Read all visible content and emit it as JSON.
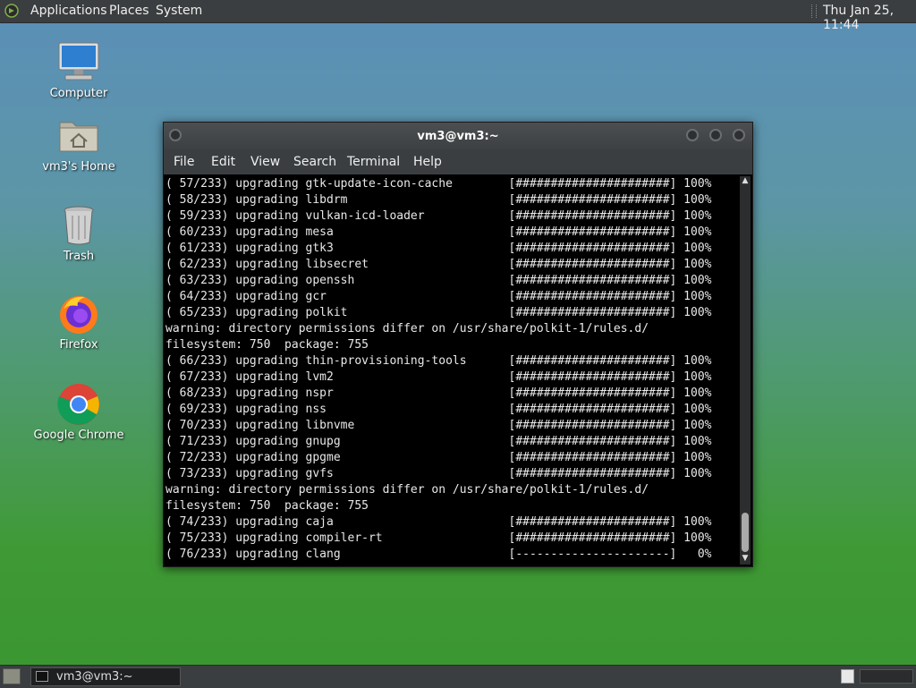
{
  "top_panel": {
    "menus": [
      "Applications",
      "Places",
      "System"
    ],
    "clock": "Thu Jan 25, 11:44"
  },
  "desktop_icons": [
    {
      "label": "Computer",
      "icon": "computer-icon"
    },
    {
      "label": "vm3's Home",
      "icon": "home-folder-icon"
    },
    {
      "label": "Trash",
      "icon": "trash-icon"
    },
    {
      "label": "Firefox",
      "icon": "firefox-icon"
    },
    {
      "label": "Google Chrome",
      "icon": "chrome-icon"
    }
  ],
  "window": {
    "title": "vm3@vm3:~",
    "menu": [
      "File",
      "Edit",
      "View",
      "Search",
      "Terminal",
      "Help"
    ]
  },
  "terminal_lines": [
    "( 57/233) upgrading gtk-update-icon-cache        [######################] 100%",
    "( 58/233) upgrading libdrm                       [######################] 100%",
    "( 59/233) upgrading vulkan-icd-loader            [######################] 100%",
    "( 60/233) upgrading mesa                         [######################] 100%",
    "( 61/233) upgrading gtk3                         [######################] 100%",
    "( 62/233) upgrading libsecret                    [######################] 100%",
    "( 63/233) upgrading openssh                      [######################] 100%",
    "( 64/233) upgrading gcr                          [######################] 100%",
    "( 65/233) upgrading polkit                       [######################] 100%",
    "warning: directory permissions differ on /usr/share/polkit-1/rules.d/",
    "filesystem: 750  package: 755",
    "( 66/233) upgrading thin-provisioning-tools      [######################] 100%",
    "( 67/233) upgrading lvm2                         [######################] 100%",
    "( 68/233) upgrading nspr                         [######################] 100%",
    "( 69/233) upgrading nss                          [######################] 100%",
    "( 70/233) upgrading libnvme                      [######################] 100%",
    "( 71/233) upgrading gnupg                        [######################] 100%",
    "( 72/233) upgrading gpgme                        [######################] 100%",
    "( 73/233) upgrading gvfs                         [######################] 100%",
    "warning: directory permissions differ on /usr/share/polkit-1/rules.d/",
    "filesystem: 750  package: 755",
    "( 74/233) upgrading caja                         [######################] 100%",
    "( 75/233) upgrading compiler-rt                  [######################] 100%",
    "( 76/233) upgrading clang                        [----------------------]   0%"
  ],
  "taskbar": {
    "task_label": "vm3@vm3:~"
  }
}
